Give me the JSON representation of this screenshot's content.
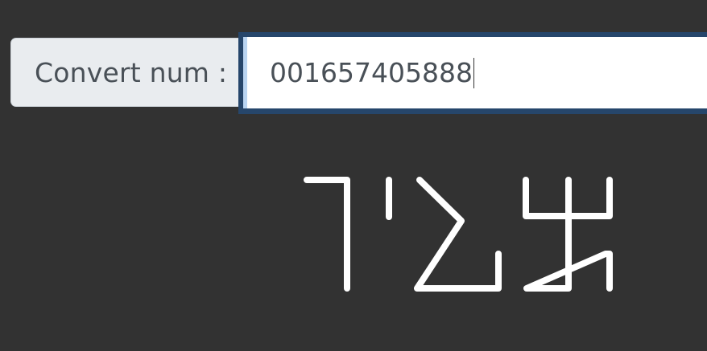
{
  "converter": {
    "label": "Convert num :",
    "value": "001657405888"
  },
  "glyph_color": "#ffffff"
}
